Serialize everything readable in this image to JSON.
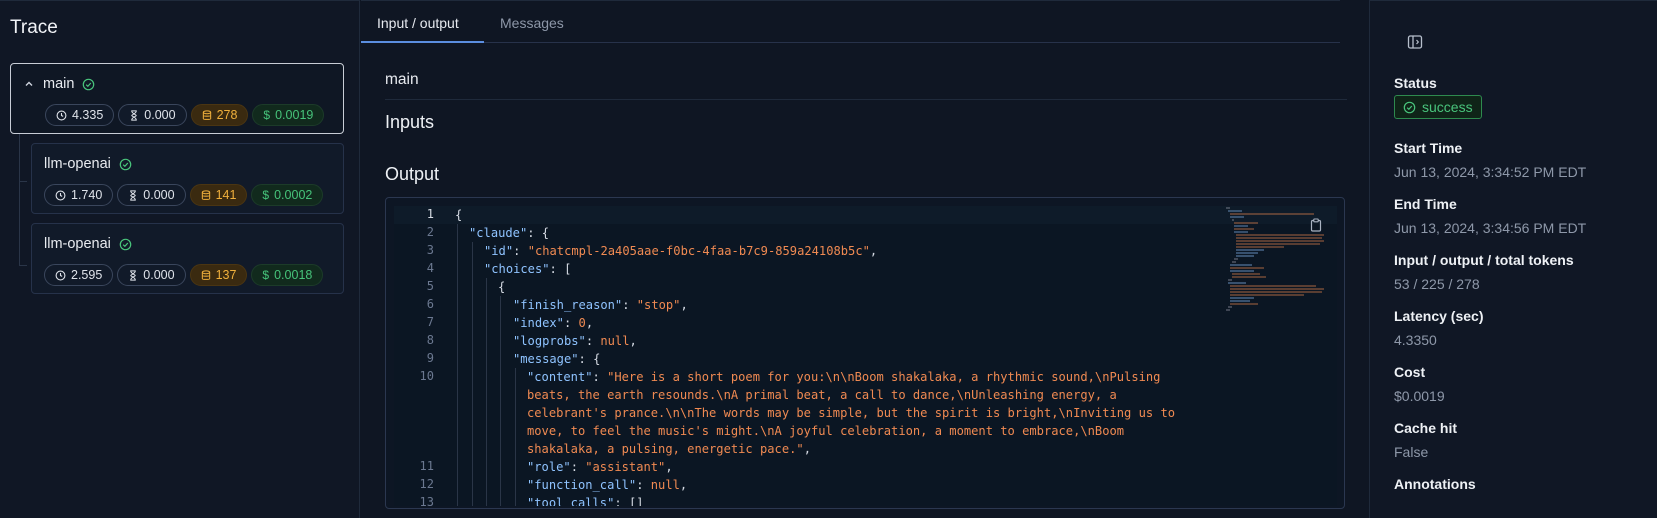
{
  "left": {
    "title": "Trace",
    "spans": [
      {
        "name": "main",
        "latency": "4.335",
        "ttft": "0.000",
        "tokens": "278",
        "cost": "0.0019"
      },
      {
        "name": "llm-openai",
        "latency": "1.740",
        "ttft": "0.000",
        "tokens": "141",
        "cost": "0.0002"
      },
      {
        "name": "llm-openai",
        "latency": "2.595",
        "ttft": "0.000",
        "tokens": "137",
        "cost": "0.0018"
      }
    ]
  },
  "tabs": [
    {
      "label": "Input / output"
    },
    {
      "label": "Messages"
    }
  ],
  "main": {
    "span_name": "main",
    "inputs_heading": "Inputs",
    "output_heading": "Output",
    "line_numbers": [
      "1",
      "2",
      "3",
      "4",
      "5",
      "6",
      "7",
      "8",
      "9",
      "10",
      "11",
      "12",
      "13"
    ],
    "code": {
      "l1": "{",
      "l2_key": "\"claude\"",
      "l3_key": "\"id\"",
      "l3_val": "\"chatcmpl-2a405aae-f0bc-4faa-b7c9-859a24108b5c\"",
      "l4_key": "\"choices\"",
      "l5": "{",
      "l6_key": "\"finish_reason\"",
      "l6_val": "\"stop\"",
      "l7_key": "\"index\"",
      "l7_val": "0",
      "l8_key": "\"logprobs\"",
      "l8_val": "null",
      "l9_key": "\"message\"",
      "l10_key": "\"content\"",
      "l10_val1": "\"Here is a short poem for you:\\n\\nBoom shakalaka, a rhythmic sound,\\nPulsing",
      "l10_val2": "beats, the earth resounds.\\nA primal beat, a call to dance,\\nUnleashing energy, a",
      "l10_val3": "celebrant's prance.\\n\\nThe words may be simple, but the spirit is bright,\\nInviting us to",
      "l10_val4": "move, to feel the music's might.\\nA joyful celebration, a moment to embrace,\\nBoom",
      "l10_val5": "shakalaka, a pulsing, energetic pace.\"",
      "l11_key": "\"role\"",
      "l11_val": "\"assistant\"",
      "l12_key": "\"function_call\"",
      "l12_val": "null",
      "l13_key": "\"tool_calls\"",
      "l13_val": "[]"
    }
  },
  "sidebar": {
    "status_label": "Status",
    "status_value": "success",
    "start_label": "Start Time",
    "start_value": "Jun 13, 2024, 3:34:52 PM EDT",
    "end_label": "End Time",
    "end_value": "Jun 13, 2024, 3:34:56 PM EDT",
    "tokens_label": "Input / output / total tokens",
    "tokens_value": "53 / 225 / 278",
    "latency_label": "Latency (sec)",
    "latency_value": "4.3350",
    "cost_label": "Cost",
    "cost_value": "$0.0019",
    "cache_label": "Cache hit",
    "cache_value": "False",
    "annotations_label": "Annotations"
  },
  "icons": {
    "chevron": "chevron-up-icon",
    "ok": "check-circle-icon",
    "latency": "clock-icon",
    "ttft": "hourglass-icon",
    "tokens": "database-icon",
    "cost": "dollar-icon",
    "copy": "clipboard-icon",
    "panel": "panel-toggle-icon"
  },
  "colors": {
    "accent": "#5b8ee0",
    "success": "#49c47c",
    "tokens": "#f0b03c",
    "string": "#f08a52",
    "key": "#8fc3ff"
  }
}
